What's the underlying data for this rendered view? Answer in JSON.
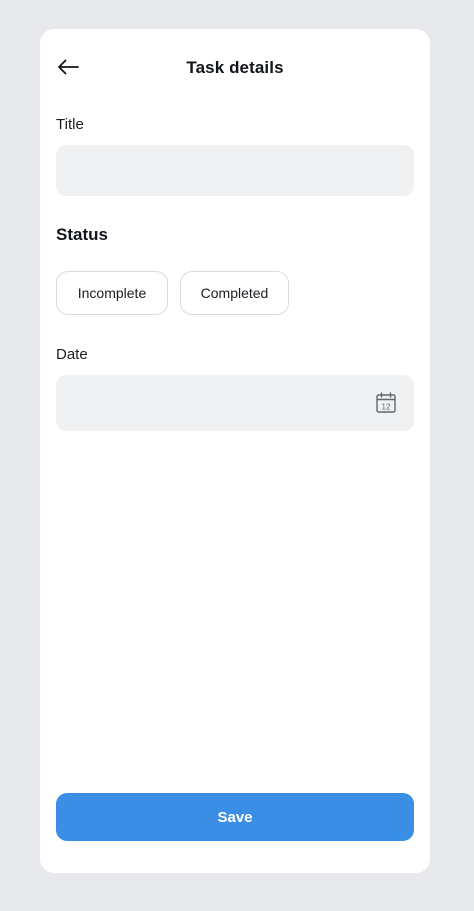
{
  "header": {
    "title": "Task details",
    "back_icon": "arrow-left-icon"
  },
  "form": {
    "title_label": "Title",
    "title_value": "",
    "title_placeholder": "",
    "status_heading": "Status",
    "status_options": [
      "Incomplete",
      "Completed"
    ],
    "date_label": "Date",
    "date_value": "",
    "date_placeholder": "",
    "date_icon": "calendar-icon",
    "calendar_icon_day": "12"
  },
  "footer": {
    "save_label": "Save"
  },
  "colors": {
    "background": "#e8e9ec",
    "card": "#ffffff",
    "input_fill": "#f0f1f2",
    "chip_border": "#d9dbde",
    "primary": "#3a8ee6"
  }
}
